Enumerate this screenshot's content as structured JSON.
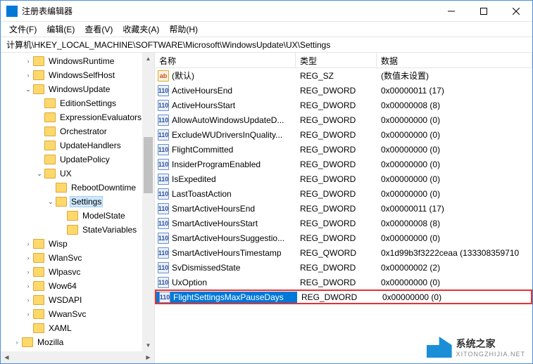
{
  "window": {
    "title": "注册表编辑器"
  },
  "menu": {
    "file": "文件(F)",
    "edit": "编辑(E)",
    "view": "查看(V)",
    "favorites": "收藏夹(A)",
    "help": "帮助(H)"
  },
  "address": "计算机\\HKEY_LOCAL_MACHINE\\SOFTWARE\\Microsoft\\WindowsUpdate\\UX\\Settings",
  "columns": {
    "name": "名称",
    "type": "类型",
    "data": "数据"
  },
  "tree": [
    {
      "label": "WindowsRuntime",
      "depth": 2,
      "arrow": "closed"
    },
    {
      "label": "WindowsSelfHost",
      "depth": 2,
      "arrow": "closed"
    },
    {
      "label": "WindowsUpdate",
      "depth": 2,
      "arrow": "open"
    },
    {
      "label": "EditionSettings",
      "depth": 3,
      "arrow": "none"
    },
    {
      "label": "ExpressionEvaluators",
      "depth": 3,
      "arrow": "none"
    },
    {
      "label": "Orchestrator",
      "depth": 3,
      "arrow": "none"
    },
    {
      "label": "UpdateHandlers",
      "depth": 3,
      "arrow": "none"
    },
    {
      "label": "UpdatePolicy",
      "depth": 3,
      "arrow": "none"
    },
    {
      "label": "UX",
      "depth": 3,
      "arrow": "open"
    },
    {
      "label": "RebootDowntime",
      "depth": 4,
      "arrow": "none"
    },
    {
      "label": "Settings",
      "depth": 4,
      "arrow": "open",
      "selected": true
    },
    {
      "label": "ModelState",
      "depth": 5,
      "arrow": "none"
    },
    {
      "label": "StateVariables",
      "depth": 5,
      "arrow": "none"
    },
    {
      "label": "Wisp",
      "depth": 2,
      "arrow": "closed"
    },
    {
      "label": "WlanSvc",
      "depth": 2,
      "arrow": "closed"
    },
    {
      "label": "Wlpasvc",
      "depth": 2,
      "arrow": "closed"
    },
    {
      "label": "Wow64",
      "depth": 2,
      "arrow": "closed"
    },
    {
      "label": "WSDAPI",
      "depth": 2,
      "arrow": "closed"
    },
    {
      "label": "WwanSvc",
      "depth": 2,
      "arrow": "closed"
    },
    {
      "label": "XAML",
      "depth": 2,
      "arrow": "none"
    },
    {
      "label": "Mozilla",
      "depth": 1,
      "arrow": "closed"
    }
  ],
  "values": [
    {
      "icon": "str",
      "name": "(默认)",
      "type": "REG_SZ",
      "data": "(数值未设置)"
    },
    {
      "icon": "bin",
      "name": "ActiveHoursEnd",
      "type": "REG_DWORD",
      "data": "0x00000011 (17)"
    },
    {
      "icon": "bin",
      "name": "ActiveHoursStart",
      "type": "REG_DWORD",
      "data": "0x00000008 (8)"
    },
    {
      "icon": "bin",
      "name": "AllowAutoWindowsUpdateD...",
      "type": "REG_DWORD",
      "data": "0x00000000 (0)"
    },
    {
      "icon": "bin",
      "name": "ExcludeWUDriversInQuality...",
      "type": "REG_DWORD",
      "data": "0x00000000 (0)"
    },
    {
      "icon": "bin",
      "name": "FlightCommitted",
      "type": "REG_DWORD",
      "data": "0x00000000 (0)"
    },
    {
      "icon": "bin",
      "name": "InsiderProgramEnabled",
      "type": "REG_DWORD",
      "data": "0x00000000 (0)"
    },
    {
      "icon": "bin",
      "name": "IsExpedited",
      "type": "REG_DWORD",
      "data": "0x00000000 (0)"
    },
    {
      "icon": "bin",
      "name": "LastToastAction",
      "type": "REG_DWORD",
      "data": "0x00000000 (0)"
    },
    {
      "icon": "bin",
      "name": "SmartActiveHoursEnd",
      "type": "REG_DWORD",
      "data": "0x00000011 (17)"
    },
    {
      "icon": "bin",
      "name": "SmartActiveHoursStart",
      "type": "REG_DWORD",
      "data": "0x00000008 (8)"
    },
    {
      "icon": "bin",
      "name": "SmartActiveHoursSuggestio...",
      "type": "REG_DWORD",
      "data": "0x00000000 (0)"
    },
    {
      "icon": "bin",
      "name": "SmartActiveHoursTimestamp",
      "type": "REG_QWORD",
      "data": "0x1d99b3f3222ceaa (133308359710"
    },
    {
      "icon": "bin",
      "name": "SvDismissedState",
      "type": "REG_DWORD",
      "data": "0x00000002 (2)"
    },
    {
      "icon": "bin",
      "name": "UxOption",
      "type": "REG_DWORD",
      "data": "0x00000000 (0)"
    },
    {
      "icon": "bin",
      "name": "FlightSettingsMaxPauseDays",
      "type": "REG_DWORD",
      "data": "0x00000000 (0)",
      "highlighted": true
    }
  ],
  "watermark": {
    "name": "系统之家",
    "sub": "XITONGZHIJIA.NET"
  }
}
